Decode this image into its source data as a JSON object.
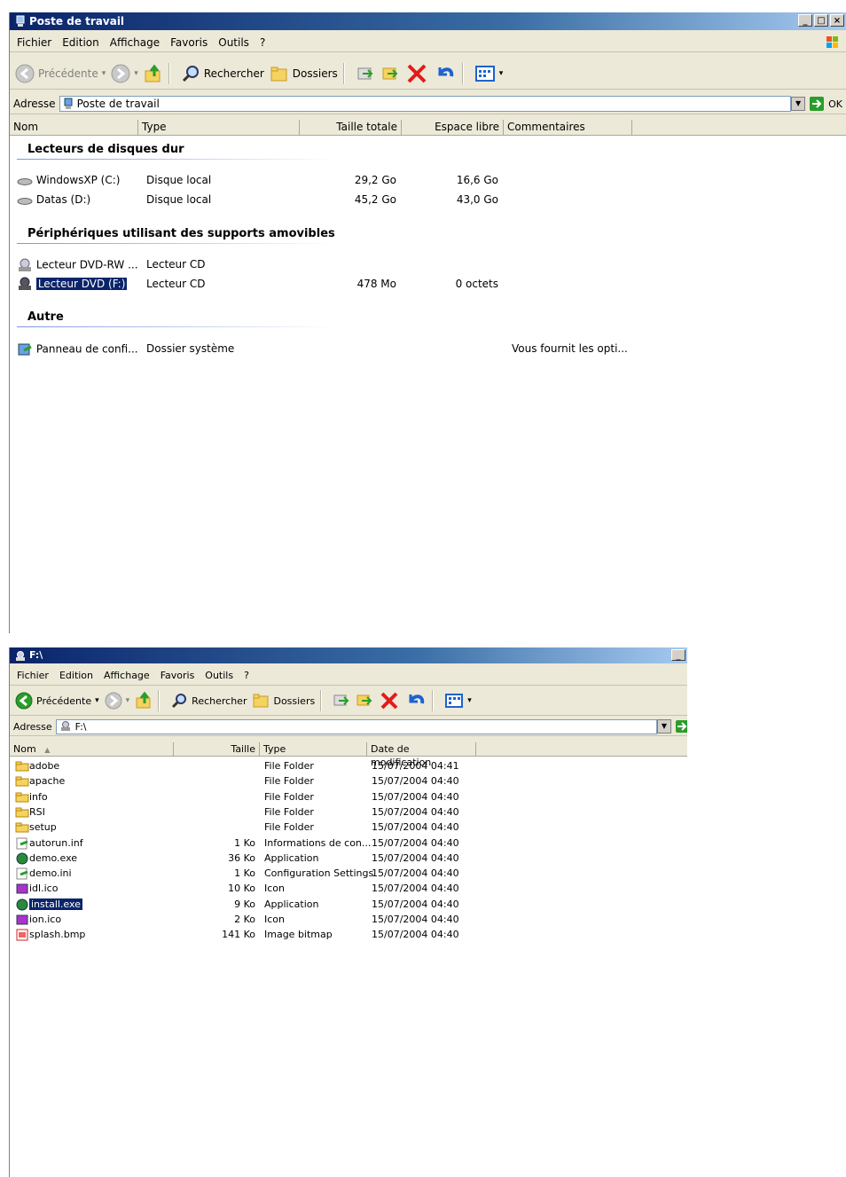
{
  "win1": {
    "title": "Poste de travail",
    "menu": [
      "Fichier",
      "Edition",
      "Affichage",
      "Favoris",
      "Outils",
      "?"
    ],
    "toolbar": {
      "back": "Précédente",
      "search": "Rechercher",
      "folders": "Dossiers"
    },
    "address": {
      "label": "Adresse",
      "value": "Poste de travail",
      "go": "OK"
    },
    "columns": [
      "Nom",
      "Type",
      "Taille totale",
      "Espace libre",
      "Commentaires"
    ],
    "groups": [
      {
        "title": "Lecteurs de disques dur",
        "items": [
          {
            "name": "WindowsXP (C:)",
            "type": "Disque local",
            "total": "29,2 Go",
            "free": "16,6 Go",
            "comment": ""
          },
          {
            "name": "Datas (D:)",
            "type": "Disque local",
            "total": "45,2 Go",
            "free": "43,0 Go",
            "comment": ""
          }
        ]
      },
      {
        "title": "Périphériques utilisant des supports amovibles",
        "items": [
          {
            "name": "Lecteur DVD-RW ...",
            "type": "Lecteur CD",
            "total": "",
            "free": "",
            "comment": ""
          },
          {
            "name": "Lecteur DVD (F:)",
            "type": "Lecteur CD",
            "total": "478 Mo",
            "free": "0 octets",
            "comment": ""
          }
        ]
      },
      {
        "title": "Autre",
        "items": [
          {
            "name": "Panneau de confi...",
            "type": "Dossier système",
            "total": "",
            "free": "",
            "comment": "Vous fournit les opti..."
          }
        ]
      }
    ]
  },
  "win2": {
    "title": "F:\\",
    "menu": [
      "Fichier",
      "Edition",
      "Affichage",
      "Favoris",
      "Outils",
      "?"
    ],
    "toolbar": {
      "back": "Précédente",
      "search": "Rechercher",
      "folders": "Dossiers"
    },
    "address": {
      "label": "Adresse",
      "value": "F:\\"
    },
    "columns": [
      "Nom",
      "Taille",
      "Type",
      "Date de modification"
    ],
    "files": [
      {
        "name": "adobe",
        "size": "",
        "type": "File Folder",
        "date": "15/07/2004 04:41"
      },
      {
        "name": "apache",
        "size": "",
        "type": "File Folder",
        "date": "15/07/2004 04:40"
      },
      {
        "name": "info",
        "size": "",
        "type": "File Folder",
        "date": "15/07/2004 04:40"
      },
      {
        "name": "RSI",
        "size": "",
        "type": "File Folder",
        "date": "15/07/2004 04:40"
      },
      {
        "name": "setup",
        "size": "",
        "type": "File Folder",
        "date": "15/07/2004 04:40"
      },
      {
        "name": "autorun.inf",
        "size": "1 Ko",
        "type": "Informations de con...",
        "date": "15/07/2004 04:40"
      },
      {
        "name": "demo.exe",
        "size": "36 Ko",
        "type": "Application",
        "date": "15/07/2004 04:40"
      },
      {
        "name": "demo.ini",
        "size": "1 Ko",
        "type": "Configuration Settings",
        "date": "15/07/2004 04:40"
      },
      {
        "name": "idl.ico",
        "size": "10 Ko",
        "type": "Icon",
        "date": "15/07/2004 04:40"
      },
      {
        "name": "install.exe",
        "size": "9 Ko",
        "type": "Application",
        "date": "15/07/2004 04:40"
      },
      {
        "name": "ion.ico",
        "size": "2 Ko",
        "type": "Icon",
        "date": "15/07/2004 04:40"
      },
      {
        "name": "splash.bmp",
        "size": "141 Ko",
        "type": "Image bitmap",
        "date": "15/07/2004 04:40"
      }
    ]
  }
}
